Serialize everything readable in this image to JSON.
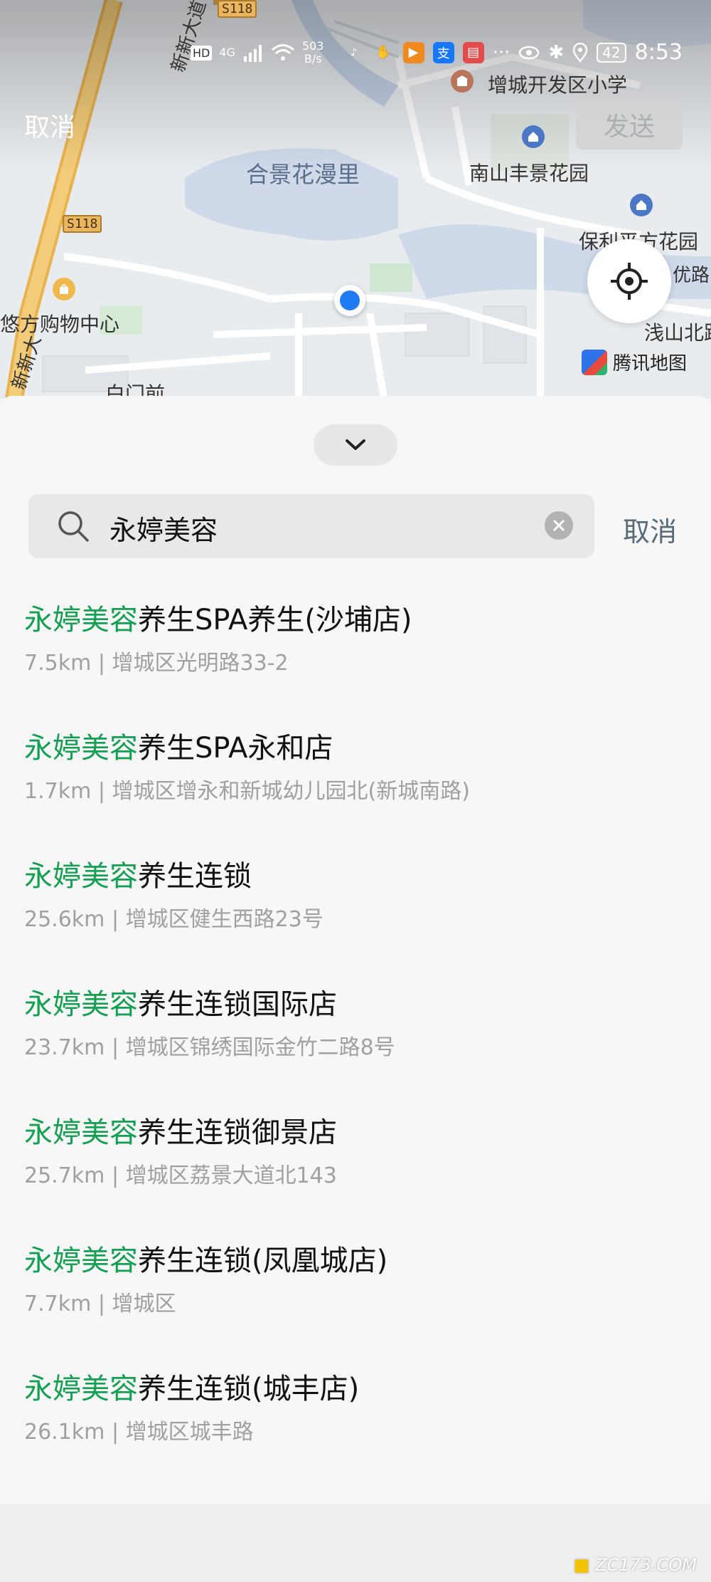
{
  "status_bar": {
    "network_hd": "HD",
    "network_4g": "4G",
    "speed_value": "503",
    "speed_unit": "B/s",
    "app_icon_1": "支",
    "battery": "42",
    "time": "8:53"
  },
  "header": {
    "cancel_label": "取消",
    "send_label": "发送"
  },
  "map": {
    "labels": {
      "school": "增城开发区小学",
      "road_main": "新新大道中",
      "road_main_2": "新新大",
      "shield_1": "S118",
      "shield_2": "S118",
      "hejing": "合景花漫里",
      "nanshan": "南山丰景花园",
      "baoli": "保利平方花园",
      "youyou": "优路",
      "youfang": "悠方购物中心",
      "qianshan": "浅山北路",
      "baimen": "白门前"
    },
    "attribution": "腾讯地图",
    "icons": {
      "locate": "crosshair-icon",
      "user_location": "location-dot"
    }
  },
  "search": {
    "query": "永婷美容",
    "cancel_label": "取消"
  },
  "results": [
    {
      "highlight": "永婷美容",
      "rest": "养生SPA养生(沙埔店)",
      "distance": "7.5km",
      "address": "增城区光明路33-2"
    },
    {
      "highlight": "永婷美容",
      "rest": "养生SPA永和店",
      "distance": "1.7km",
      "address": "增城区增永和新城幼儿园北(新城南路)"
    },
    {
      "highlight": "永婷美容",
      "rest": "养生连锁",
      "distance": "25.6km",
      "address": "增城区健生西路23号"
    },
    {
      "highlight": "永婷美容",
      "rest": "养生连锁国际店",
      "distance": "23.7km",
      "address": "增城区锦绣国际金竹二路8号"
    },
    {
      "highlight": "永婷美容",
      "rest": "养生连锁御景店",
      "distance": "25.7km",
      "address": "增城区荔景大道北143"
    },
    {
      "highlight": "永婷美容",
      "rest": "养生连锁(凤凰城店)",
      "distance": "7.7km",
      "address": "增城区"
    },
    {
      "highlight": "永婷美容",
      "rest": "养生连锁(城丰店)",
      "distance": "26.1km",
      "address": "增城区城丰路"
    }
  ],
  "separator": " | ",
  "watermark": "ZC173.COM",
  "colors": {
    "highlight": "#12a150",
    "location": "#1e7bf4",
    "cancel_text": "#586b7a"
  }
}
